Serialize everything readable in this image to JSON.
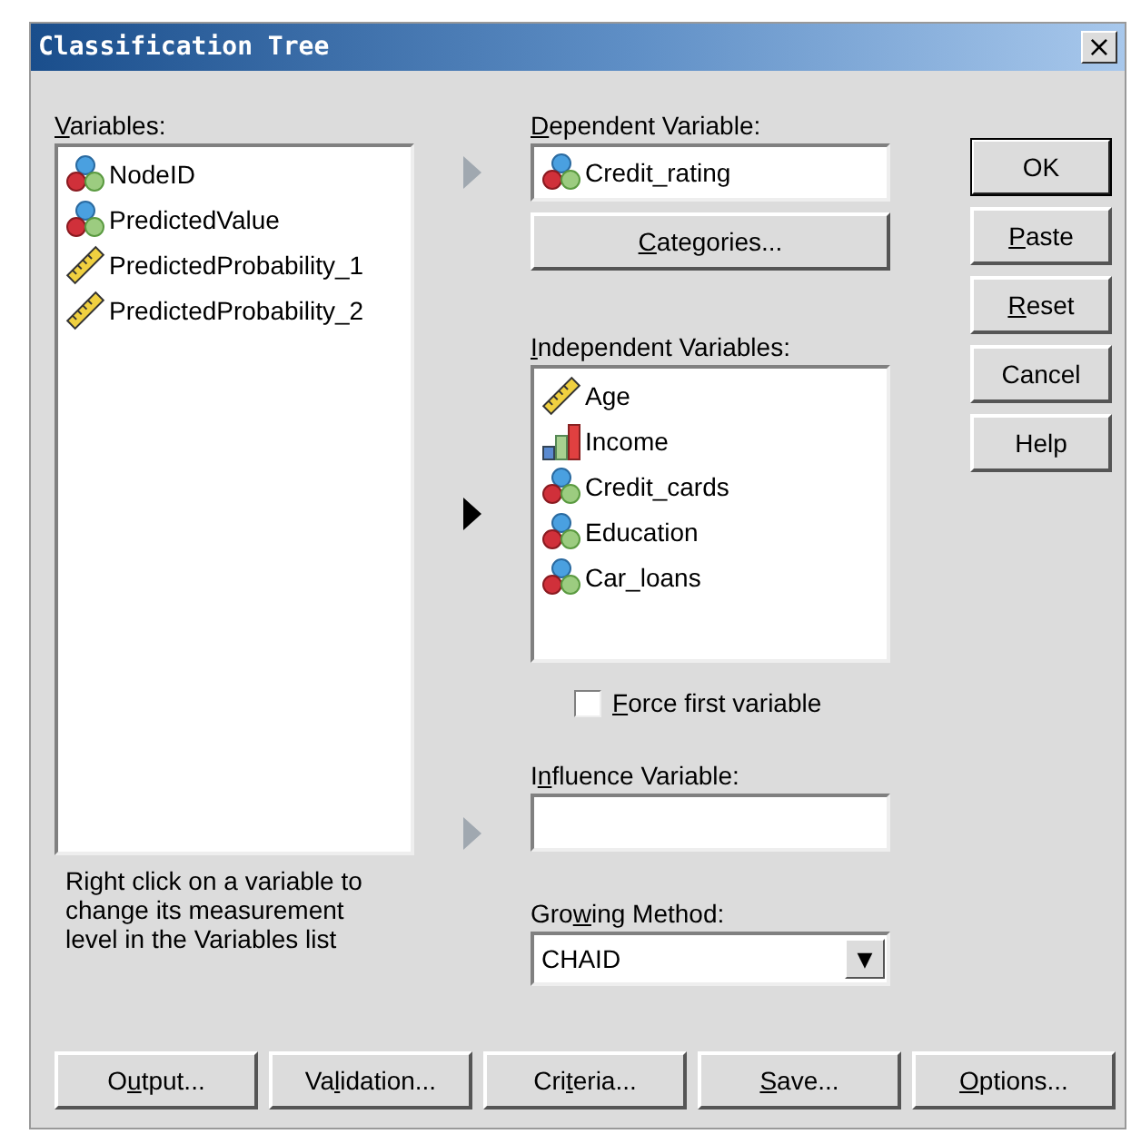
{
  "window": {
    "title": "Classification Tree",
    "close": "×"
  },
  "variables": {
    "label": {
      "key": "V",
      "post": "ariables:"
    },
    "items": [
      {
        "kind": "nominal",
        "name": "NodeID"
      },
      {
        "kind": "nominal",
        "name": "PredictedValue"
      },
      {
        "kind": "scale",
        "name": "PredictedProbability_1"
      },
      {
        "kind": "scale",
        "name": "PredictedProbability_2"
      }
    ],
    "note": "Right click on a variable to change its measurement level in the Variables list"
  },
  "dependent": {
    "label": {
      "key": "D",
      "post": "ependent Variable:"
    },
    "arrow_disabled": true,
    "value": {
      "kind": "nominal",
      "name": "Credit_rating"
    },
    "button": {
      "key": "C",
      "post": "ategories..."
    }
  },
  "independent": {
    "label": {
      "key": "I",
      "post": "ndependent Variables:"
    },
    "arrow_disabled": false,
    "items": [
      {
        "kind": "scale",
        "name": "Age"
      },
      {
        "kind": "ordinal",
        "name": "Income"
      },
      {
        "kind": "nominal",
        "name": "Credit_cards"
      },
      {
        "kind": "nominal",
        "name": "Education"
      },
      {
        "kind": "nominal",
        "name": "Car_loans"
      }
    ],
    "force_first": {
      "label": {
        "key": "F",
        "post": "orce first variable"
      },
      "checked": false
    }
  },
  "influence": {
    "label": {
      "pre": "I",
      "key": "n",
      "post": "fluence Variable:"
    },
    "arrow_disabled": true
  },
  "growing": {
    "label": {
      "pre": "Gro",
      "key": "w",
      "post": "ing Method:"
    },
    "value": "CHAID",
    "caret": "▼"
  },
  "side_buttons": [
    {
      "pre": "OK",
      "default": true
    },
    {
      "key": "P",
      "post": "aste",
      "default": false
    },
    {
      "key": "R",
      "post": "eset",
      "default": false
    },
    {
      "pre": "Cancel",
      "default": false
    },
    {
      "pre": "Help",
      "default": false
    }
  ],
  "bottom_buttons": [
    {
      "pre": "O",
      "key": "u",
      "post": "tput..."
    },
    {
      "pre": "Va",
      "key": "l",
      "post": "idation..."
    },
    {
      "pre": "Cri",
      "key": "t",
      "post": "eria..."
    },
    {
      "key": "S",
      "post": "ave..."
    },
    {
      "key": "O",
      "post": "ptions..."
    }
  ]
}
